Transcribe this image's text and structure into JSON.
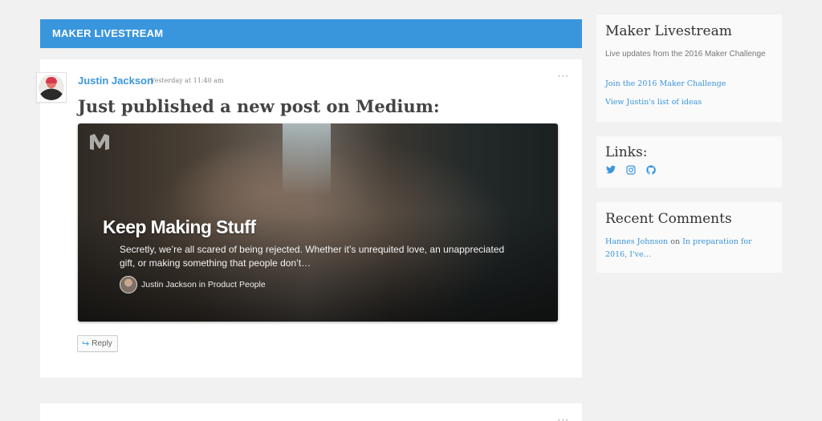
{
  "banner": {
    "title": "MAKER LIVESTREAM"
  },
  "post": {
    "author": "Justin Jackson",
    "time": "Yesterday at 11:40 am",
    "more": "···",
    "headline": "Just published a new post on Medium:",
    "card": {
      "title": "Keep Making Stuff",
      "description": "Secretly, we’re all scared of being rejected. Whether it’s unrequited love, an unappreciated gift, or making something that people don’t…",
      "author_line": "Justin Jackson in Product People"
    },
    "reply_label": "Reply"
  },
  "post2": {
    "more": "···"
  },
  "sidebar": {
    "livestream": {
      "title": "Maker Livestream",
      "description": "Live updates from the 2016 Maker Challenge",
      "links": [
        "Join the 2016 Maker Challenge",
        "View Justin's list of ideas"
      ]
    },
    "links": {
      "title": "Links:",
      "icons": [
        "twitter-icon",
        "instagram-icon",
        "github-icon"
      ]
    },
    "recent_comments": {
      "title": "Recent Comments",
      "comment_author": "Hannes Johnson",
      "comment_on": "on",
      "comment_post": "In preparation for 2016, I've…"
    }
  },
  "colors": {
    "accent": "#3a96dc",
    "background": "#f1f1f1"
  }
}
